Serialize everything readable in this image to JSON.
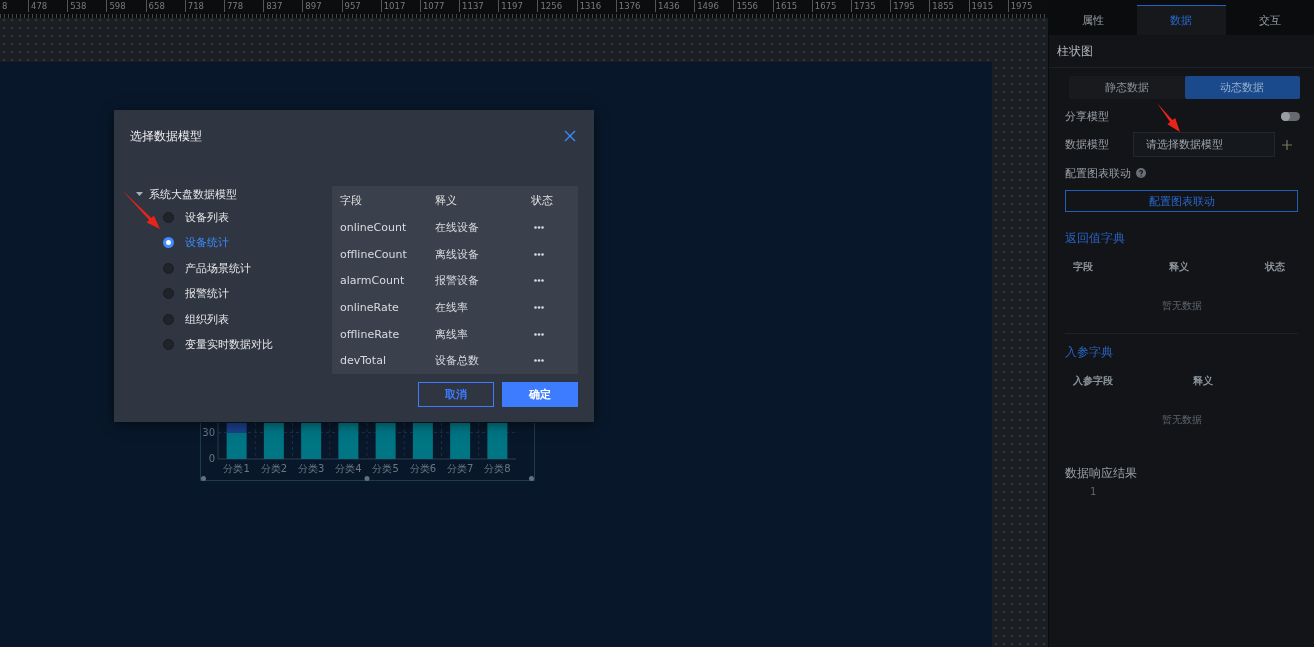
{
  "ruler": {
    "labels": [
      "8",
      "478",
      "538",
      "598",
      "658",
      "718",
      "778",
      "837",
      "897",
      "957",
      "1017",
      "1077",
      "1137",
      "1197",
      "1256",
      "1316",
      "1376",
      "1436",
      "1496",
      "1556",
      "1615",
      "1675",
      "1735",
      "1795",
      "1855",
      "1915",
      "1975"
    ]
  },
  "chart_widget": {
    "y_tick_labels": [
      "30",
      "0"
    ],
    "categories": [
      "分类1",
      "分类2",
      "分类3",
      "分类4",
      "分类5",
      "分类6",
      "分类7",
      "分类8"
    ]
  },
  "dialog": {
    "title": "选择数据模型",
    "tree": {
      "label": "系统大盘数据模型",
      "expanded": true,
      "children": [
        {
          "label": "设备列表",
          "selected": false
        },
        {
          "label": "设备统计",
          "selected": true
        },
        {
          "label": "产品场景统计",
          "selected": false
        },
        {
          "label": "报警统计",
          "selected": false
        },
        {
          "label": "组织列表",
          "selected": false
        },
        {
          "label": "变量实时数据对比",
          "selected": false
        }
      ]
    },
    "table": {
      "columns": [
        "字段",
        "释义",
        "状态"
      ],
      "rows": [
        {
          "field": "onlineCount",
          "meaning": "在线设备"
        },
        {
          "field": "offlineCount",
          "meaning": "离线设备"
        },
        {
          "field": "alarmCount",
          "meaning": "报警设备"
        },
        {
          "field": "onlineRate",
          "meaning": "在线率"
        },
        {
          "field": "offlineRate",
          "meaning": "离线率"
        },
        {
          "field": "devTotal",
          "meaning": "设备总数"
        }
      ]
    },
    "buttons": [
      {
        "label": "取消",
        "kind": "secondary"
      },
      {
        "label": "确定",
        "kind": "primary"
      }
    ]
  },
  "panel": {
    "tabs": [
      {
        "label": "属性",
        "selected": false
      },
      {
        "label": "数据",
        "selected": true
      },
      {
        "label": "交互",
        "selected": false
      }
    ],
    "title": "柱状图",
    "source_tabs": [
      {
        "label": "静态数据",
        "selected": false
      },
      {
        "label": "动态数据",
        "selected": true
      }
    ],
    "share_model": {
      "label": "分享模型",
      "on": false
    },
    "data_model": {
      "label": "数据模型",
      "placeholder": "请选择数据模型"
    },
    "linkage": {
      "label": "配置图表联动",
      "button": "配置图表联动"
    },
    "return_dict": {
      "title": "返回值字典",
      "columns": [
        "字段",
        "释义",
        "状态"
      ],
      "empty": "暂无数据"
    },
    "param_dict": {
      "title": "入参字典",
      "columns": [
        "入参字段",
        "释义"
      ],
      "empty": "暂无数据"
    },
    "response": {
      "title": "数据响应结果",
      "line_numbers": [
        "1"
      ]
    }
  }
}
